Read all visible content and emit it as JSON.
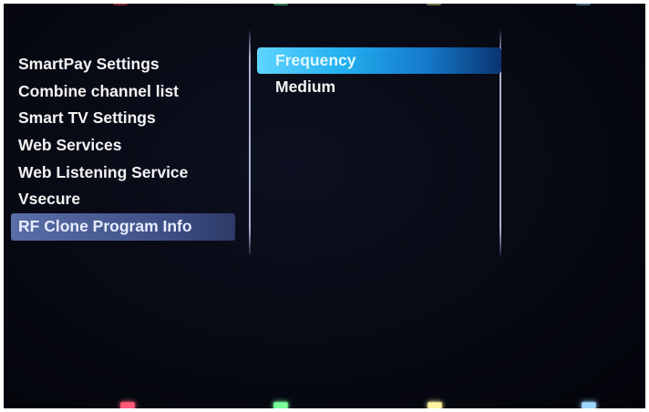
{
  "menu": {
    "items": [
      {
        "label": "SmartPay Settings"
      },
      {
        "label": "Combine channel list"
      },
      {
        "label": "Smart TV Settings"
      },
      {
        "label": "Web Services"
      },
      {
        "label": "Web Listening Service"
      },
      {
        "label": "Vsecure"
      },
      {
        "label": "RF Clone Program Info"
      }
    ],
    "selected_index": 6
  },
  "submenu": {
    "items": [
      {
        "label": "Frequency"
      },
      {
        "label": "Medium"
      }
    ],
    "highlighted_index": 0
  },
  "color_keys": [
    {
      "name": "red",
      "color": "#ff5a78"
    },
    {
      "name": "green",
      "color": "#78ff9a"
    },
    {
      "name": "yellow",
      "color": "#fff2a0"
    },
    {
      "name": "blue",
      "color": "#9fd6ff"
    }
  ]
}
